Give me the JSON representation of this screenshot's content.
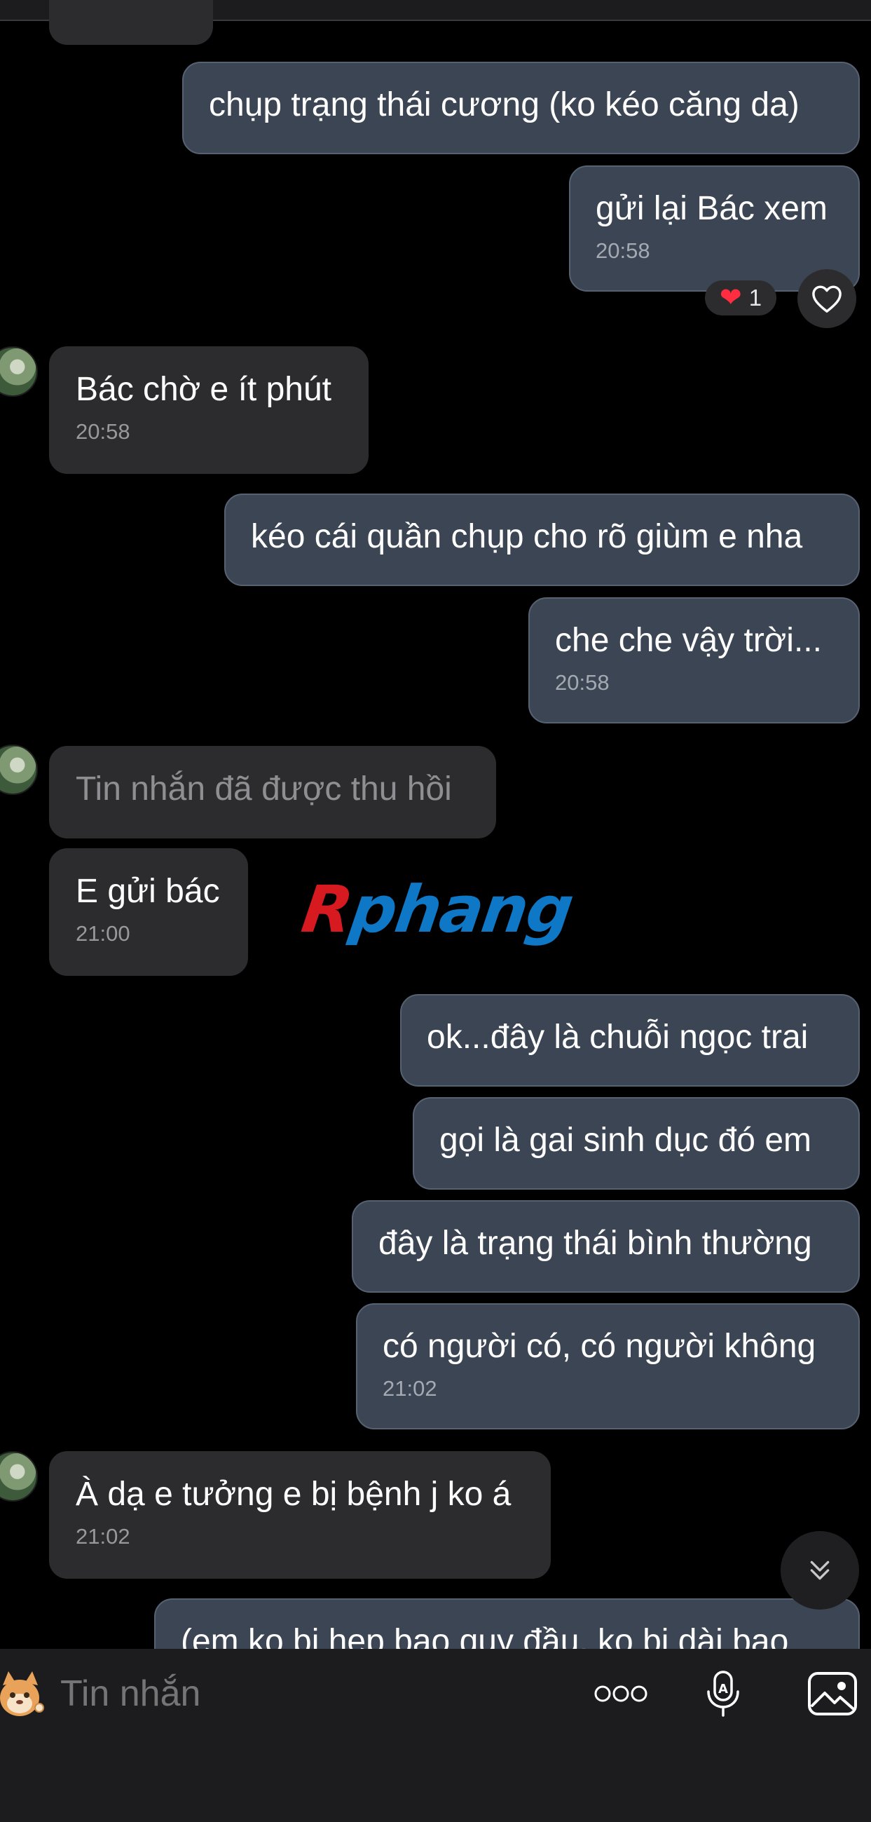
{
  "conversation": {
    "messages": [
      {
        "text": "chụp trạng thái cương (ko kéo căng da)"
      },
      {
        "text": "gửi lại Bác xem",
        "time": "20:58"
      },
      {
        "text": "Bác chờ e ít phút",
        "time": "20:58"
      },
      {
        "text": "kéo cái quần chụp cho rõ giùm e nha"
      },
      {
        "text": "che che vậy trời...",
        "time": "20:58"
      },
      {
        "text": "Tin nhắn đã được thu hồi"
      },
      {
        "text": "E gửi bác",
        "time": "21:00"
      },
      {
        "text": "ok...đây là chuỗi ngọc trai"
      },
      {
        "text": "gọi là gai sinh dục đó em"
      },
      {
        "text": "đây là trạng thái bình thường"
      },
      {
        "text": "có người có, có người không",
        "time": "21:02"
      },
      {
        "text": "À dạ e tưởng e bị bệnh j ko á",
        "time": "21:02"
      },
      {
        "text": "(em ko bị hẹp bao quy đầu, ko bị dài bao"
      }
    ],
    "reaction": {
      "emoji": "❤️",
      "count": "1",
      "heart_color": "#ff2d3f"
    }
  },
  "watermark": {
    "first": "R",
    "rest": "phang"
  },
  "composer": {
    "placeholder": "Tin nhắn",
    "more_icon": "more-options-icon",
    "voice_icon": "voice-to-text-icon",
    "image_icon": "image-gallery-icon"
  },
  "colors": {
    "background": "#000000",
    "outgoing_bubble": "#3b4553",
    "incoming_bubble": "#2c2c2e",
    "composer_bar": "#1c1c1e"
  }
}
